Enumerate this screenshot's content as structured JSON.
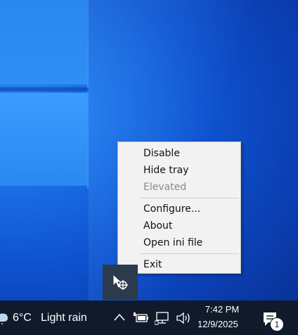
{
  "context_menu": {
    "items": [
      {
        "label": "Disable",
        "enabled": true
      },
      {
        "label": "Hide tray",
        "enabled": true
      },
      {
        "label": "Elevated",
        "enabled": false
      },
      {
        "label": "Configure...",
        "enabled": true
      },
      {
        "label": "About",
        "enabled": true
      },
      {
        "label": "Open ini file",
        "enabled": true
      },
      {
        "label": "Exit",
        "enabled": true
      }
    ]
  },
  "taskbar": {
    "weather": {
      "temperature": "6°C",
      "condition": "Light rain",
      "icon": "rain-cloud-icon"
    },
    "tray_icons": [
      "show-hidden-icons-chevron",
      "battery-plug-icon",
      "network-icon",
      "volume-icon"
    ],
    "clock": {
      "time": "7:42 PM",
      "date": "12/9/2025"
    },
    "notifications": {
      "count": "1",
      "icon": "action-center-icon"
    }
  },
  "tray_overflow": {
    "icon": "app-tray-icon"
  },
  "colors": {
    "desktop_blue": "#0f52cf",
    "taskbar": "#101a2a",
    "menu_bg": "#f2f2f2",
    "menu_disabled_text": "#8a8a8a"
  }
}
